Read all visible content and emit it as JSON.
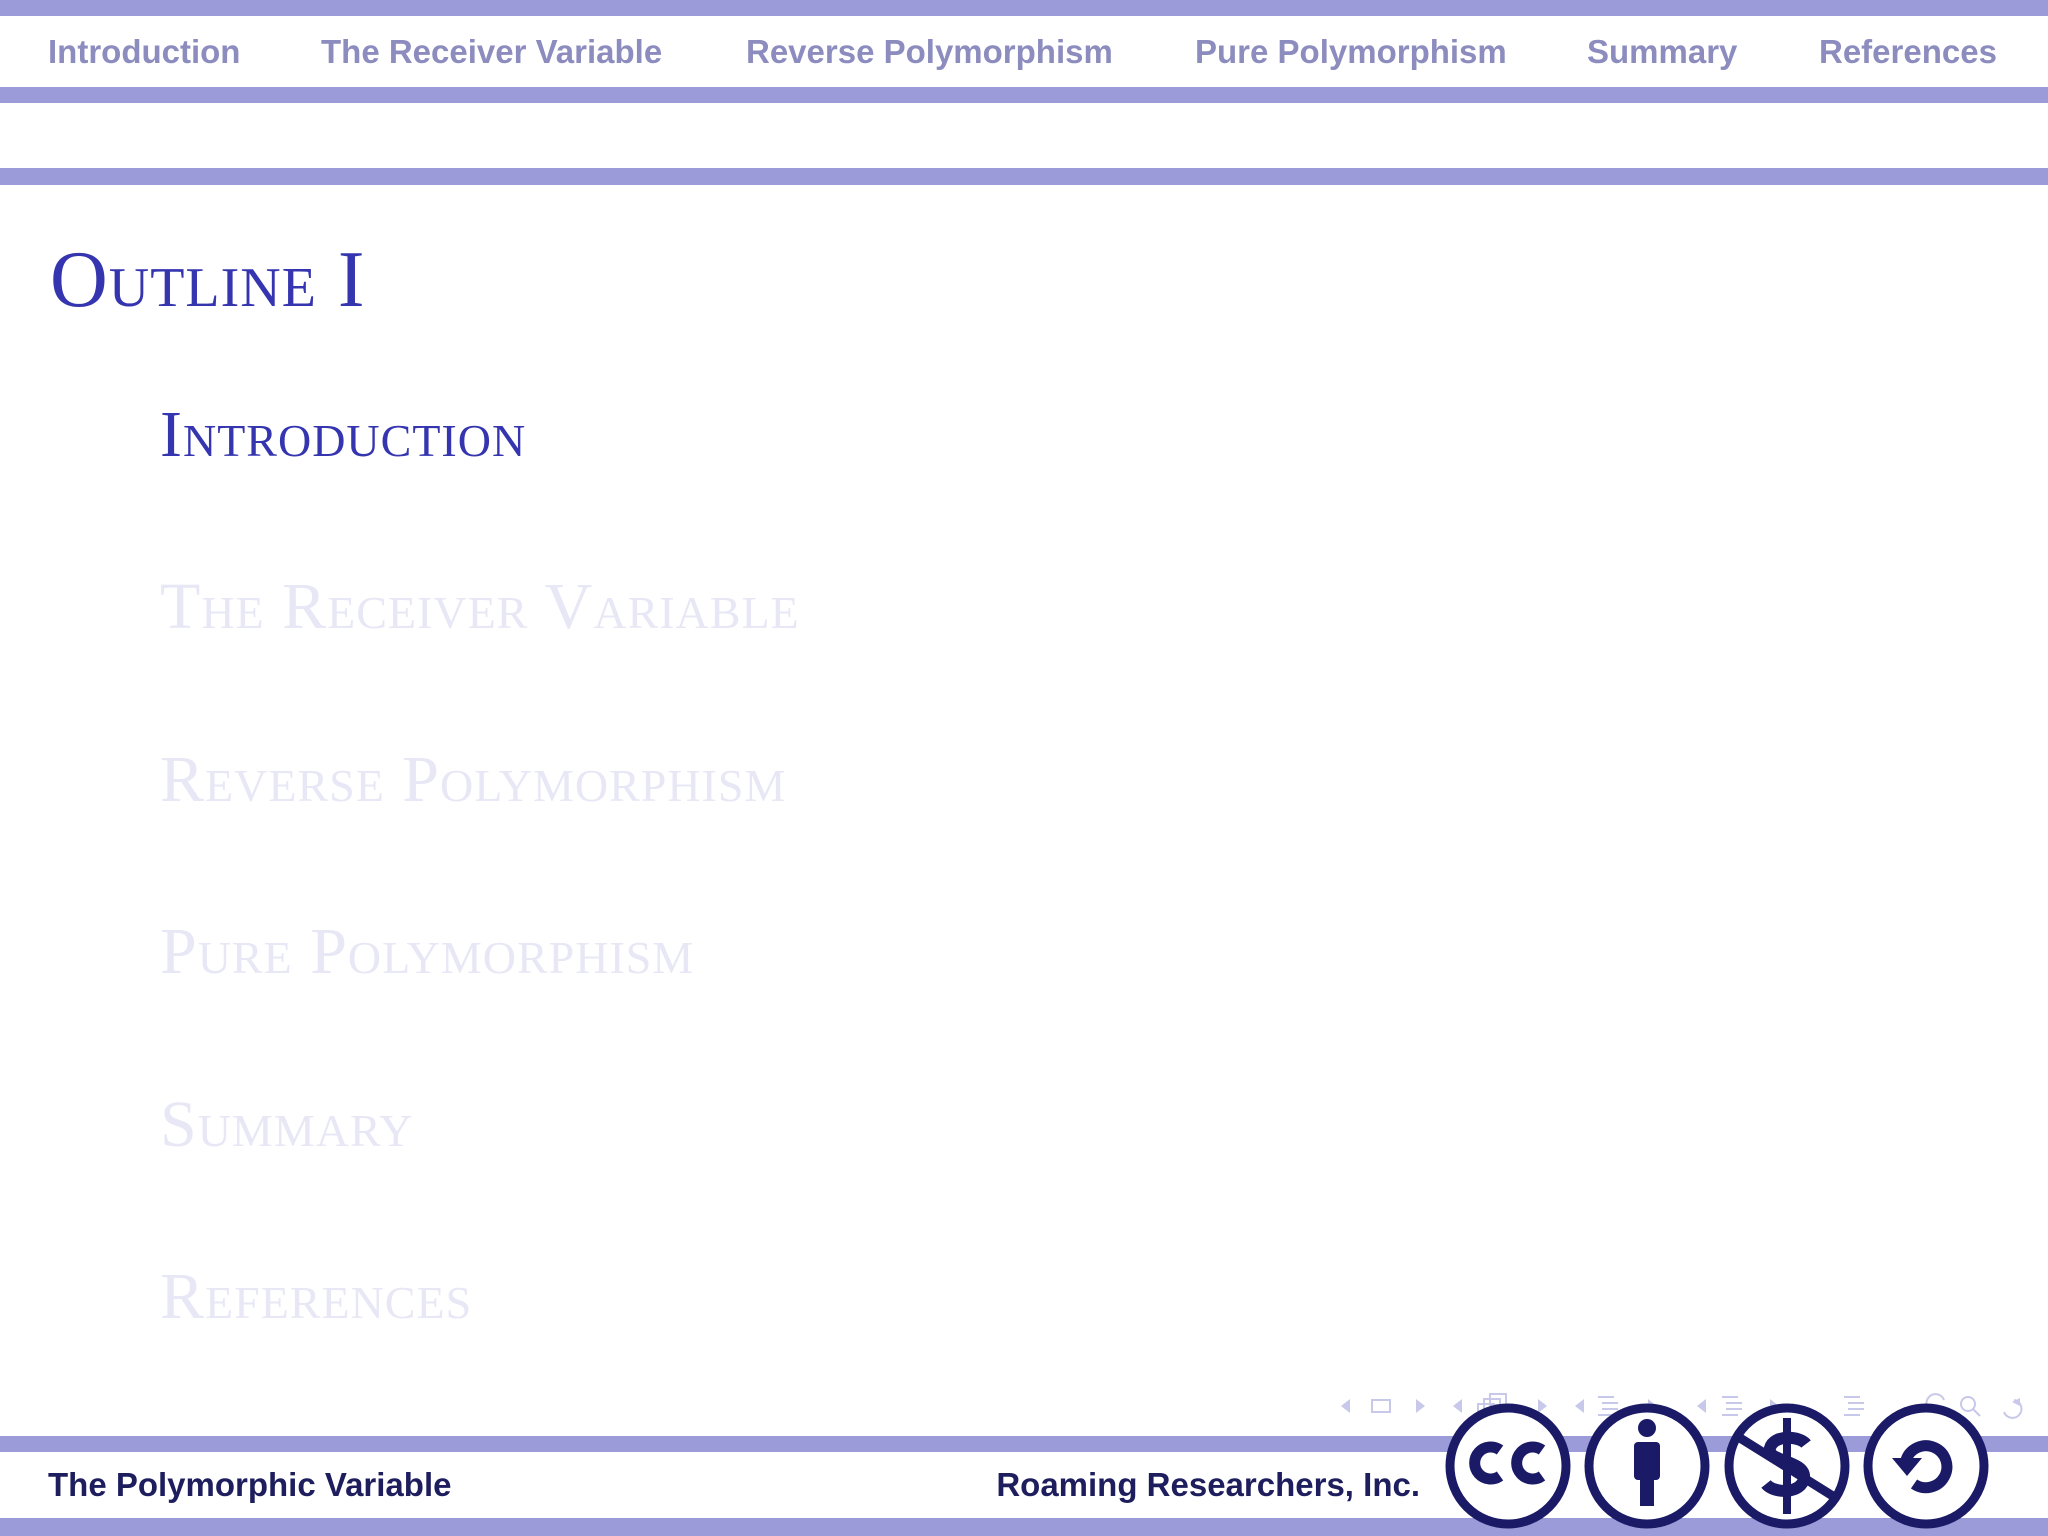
{
  "nav": {
    "items": [
      {
        "label": "Introduction"
      },
      {
        "label": "The Receiver Variable"
      },
      {
        "label": "Reverse Polymorphism"
      },
      {
        "label": "Pure Polymorphism"
      },
      {
        "label": "Summary"
      },
      {
        "label": "References"
      }
    ]
  },
  "frame": {
    "title": "Outline I"
  },
  "toc": {
    "items": [
      {
        "label": "Introduction"
      },
      {
        "label": "The Receiver Variable"
      },
      {
        "label": "Reverse Polymorphism"
      },
      {
        "label": "Pure Polymorphism"
      },
      {
        "label": "Summary"
      },
      {
        "label": "References"
      }
    ],
    "current_index": 0
  },
  "footer": {
    "left": "The Polymorphic Variable",
    "right": "Roaming Researchers, Inc."
  },
  "license": {
    "badges": [
      "cc-icon",
      "by-attribution-icon",
      "non-commercial-icon",
      "share-alike-icon"
    ]
  },
  "colors": {
    "accent": "#9b9bd9",
    "title": "#3535b0",
    "nav_text": "#8c8cbf",
    "footer_text": "#1e1e5e",
    "dim_text": "#e7e7f5",
    "badge": "#1a1a66"
  }
}
